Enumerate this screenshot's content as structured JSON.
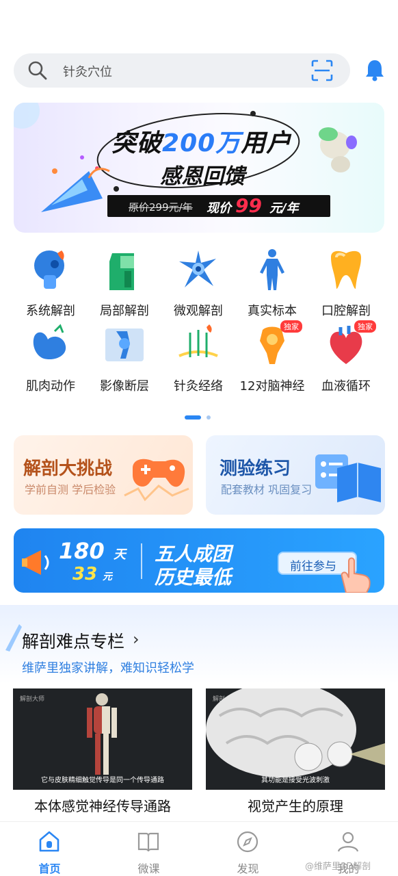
{
  "search": {
    "placeholder": "针灸穴位"
  },
  "promo": {
    "title_prefix": "突破",
    "title_highlight": "200万",
    "title_suffix": "用户",
    "subtitle": "感恩回馈",
    "old_price": "原价299元/年",
    "new_price_label": "现价",
    "new_price": "99",
    "new_price_unit": "元/年"
  },
  "categories": [
    {
      "label": "系统解剖",
      "icon": "skull-icon"
    },
    {
      "label": "局部解剖",
      "icon": "torso-icon"
    },
    {
      "label": "微观解剖",
      "icon": "neuron-icon"
    },
    {
      "label": "真实标本",
      "icon": "human-body-icon"
    },
    {
      "label": "口腔解剖",
      "icon": "tooth-icon"
    },
    {
      "label": "肌肉动作",
      "icon": "arm-muscle-icon"
    },
    {
      "label": "影像断层",
      "icon": "xray-knee-icon"
    },
    {
      "label": "针灸经络",
      "icon": "acupuncture-icon"
    },
    {
      "label": "12对脑神经",
      "icon": "brain-nerve-icon",
      "badge": "独家"
    },
    {
      "label": "血液循环",
      "icon": "heart-icon",
      "badge": "独家"
    }
  ],
  "cards": {
    "left": {
      "title": "解剖大挑战",
      "subtitle": "学前自测  学后检验"
    },
    "right": {
      "title": "测验练习",
      "subtitle": "配套教材  巩固复习"
    }
  },
  "group_banner": {
    "days": "180",
    "days_unit": "天",
    "price": "33",
    "price_unit": "元",
    "line1": "五人成团",
    "line2": "历史最低",
    "button": "前往参与"
  },
  "section": {
    "title": "解剖难点专栏",
    "chevron": "›",
    "subtitle": "维萨里独家讲解，难知识轻松学",
    "videos": [
      {
        "title": "本体感觉神经传导通路",
        "caption": "它与皮肤精细触觉传导是同一个传导通路",
        "logo": "解剖大师"
      },
      {
        "title": "视觉产生的原理",
        "caption": "其功能是接受光波刺激",
        "logo": "解剖大师"
      }
    ]
  },
  "tabs": [
    {
      "label": "首页",
      "icon": "home-icon",
      "active": true
    },
    {
      "label": "微课",
      "icon": "book-icon",
      "active": false
    },
    {
      "label": "发现",
      "icon": "compass-icon",
      "active": false
    },
    {
      "label": "我的",
      "icon": "user-icon",
      "active": false
    }
  ],
  "watermark": "@维萨里3D解剖",
  "colors": {
    "accent": "#2a86f3",
    "orange": "#b4521b",
    "blue_dark": "#1d56a8",
    "badge": "#ff3b3b"
  }
}
